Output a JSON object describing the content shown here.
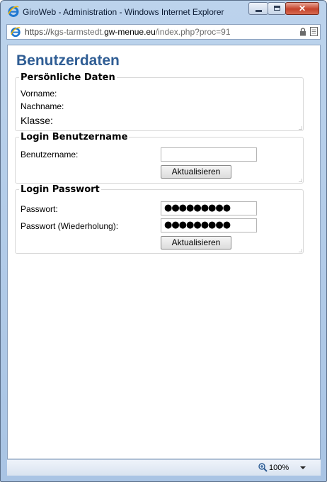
{
  "window": {
    "title": "GiroWeb - Administration - Windows Internet Explorer"
  },
  "address": {
    "scheme": "https://",
    "subdomain": "kgs-tarmstedt.",
    "domain": "gw-menue.eu",
    "path": "/index.php?proc=91"
  },
  "page": {
    "title": "Benutzerdaten",
    "personal": {
      "legend": "Persönliche Daten",
      "first_name_label": "Vorname:",
      "last_name_label": "Nachname:",
      "class_label": "Klasse:"
    },
    "login_username": {
      "legend": "Login Benutzername",
      "username_label": "Benutzername:",
      "username_value": "",
      "update_button": "Aktualisieren"
    },
    "login_password": {
      "legend": "Login Passwort",
      "password_label": "Passwort:",
      "password_value": "●●●●●●●●●",
      "repeat_label": "Passwort (Wiederholung):",
      "repeat_value": "●●●●●●●●●",
      "update_button": "Aktualisieren"
    }
  },
  "statusbar": {
    "zoom": "100%"
  },
  "colors": {
    "title_blue": "#2f5d94",
    "chrome": "#bcd3ec",
    "close_red": "#c4422b"
  },
  "icons": [
    "ie-logo-icon",
    "minimize-icon",
    "maximize-icon",
    "close-icon",
    "lock-icon",
    "page-icon",
    "zoom-icon",
    "chevron-down-icon"
  ]
}
